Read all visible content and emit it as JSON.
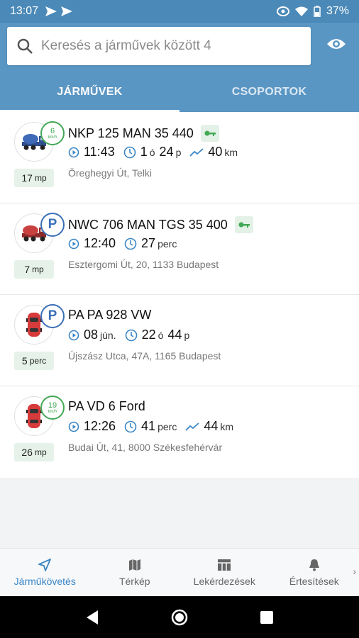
{
  "statusbar": {
    "time": "13:07",
    "battery": "37%"
  },
  "search": {
    "placeholder": "Keresés a járművek között 4"
  },
  "tabs": [
    {
      "label": "JÁRMŰVEK",
      "active": true
    },
    {
      "label": "CSOPORTOK",
      "active": false
    }
  ],
  "vehicles": [
    {
      "name": "NKP 125 MAN 35 440",
      "icon": "concrete-mixer-truck-blue",
      "status_badge": {
        "type": "speed",
        "value": "6",
        "unit": "km/h"
      },
      "ignition_key": true,
      "time": "11:43",
      "duration_a": "1",
      "duration_a_unit": "ó",
      "duration_b": "24",
      "duration_b_unit": "p",
      "distance": "40",
      "distance_unit": "km",
      "address": "Öreghegyi Út, Telki",
      "age_value": "17",
      "age_unit": "mp"
    },
    {
      "name": "NWC 706 MAN TGS 35 400",
      "icon": "concrete-mixer-truck-red",
      "status_badge": {
        "type": "parking",
        "value": "P"
      },
      "ignition_key": true,
      "time": "12:40",
      "duration_a": "27",
      "duration_a_unit": "perc",
      "address": "Esztergomi Út, 20, 1133 Budapest",
      "age_value": "7",
      "age_unit": "mp"
    },
    {
      "name": "PA PA 928 VW",
      "icon": "car-red",
      "status_badge": {
        "type": "parking",
        "value": "P"
      },
      "ignition_key": false,
      "time": "08",
      "time_unit": "jún.",
      "duration_a": "22",
      "duration_a_unit": "ó",
      "duration_b": "44",
      "duration_b_unit": "p",
      "address": "Újszász Utca, 47A, 1165 Budapest",
      "age_value": "5",
      "age_unit": "perc"
    },
    {
      "name": "PA VD 6 Ford",
      "icon": "car-red",
      "status_badge": {
        "type": "speed",
        "value": "19",
        "unit": "km/h"
      },
      "ignition_key": false,
      "time": "12:26",
      "duration_a": "41",
      "duration_a_unit": "perc",
      "distance": "44",
      "distance_unit": "km",
      "address": "Budai Út, 41, 8000 Székesfehérvár",
      "age_value": "26",
      "age_unit": "mp"
    }
  ],
  "bottom_nav": [
    {
      "label": "Járműkövetés",
      "icon": "navigation-arrow-icon",
      "active": true
    },
    {
      "label": "Térkép",
      "icon": "map-icon",
      "active": false
    },
    {
      "label": "Lekérdezések",
      "icon": "table-icon",
      "active": false
    },
    {
      "label": "Értesítések",
      "icon": "bell-icon",
      "active": false
    }
  ],
  "colors": {
    "header": "#5a96c4",
    "statusbar": "#4a89b8",
    "accent": "#3a86c5",
    "speed_green": "#43a855",
    "parking_blue": "#3a6fb8"
  }
}
